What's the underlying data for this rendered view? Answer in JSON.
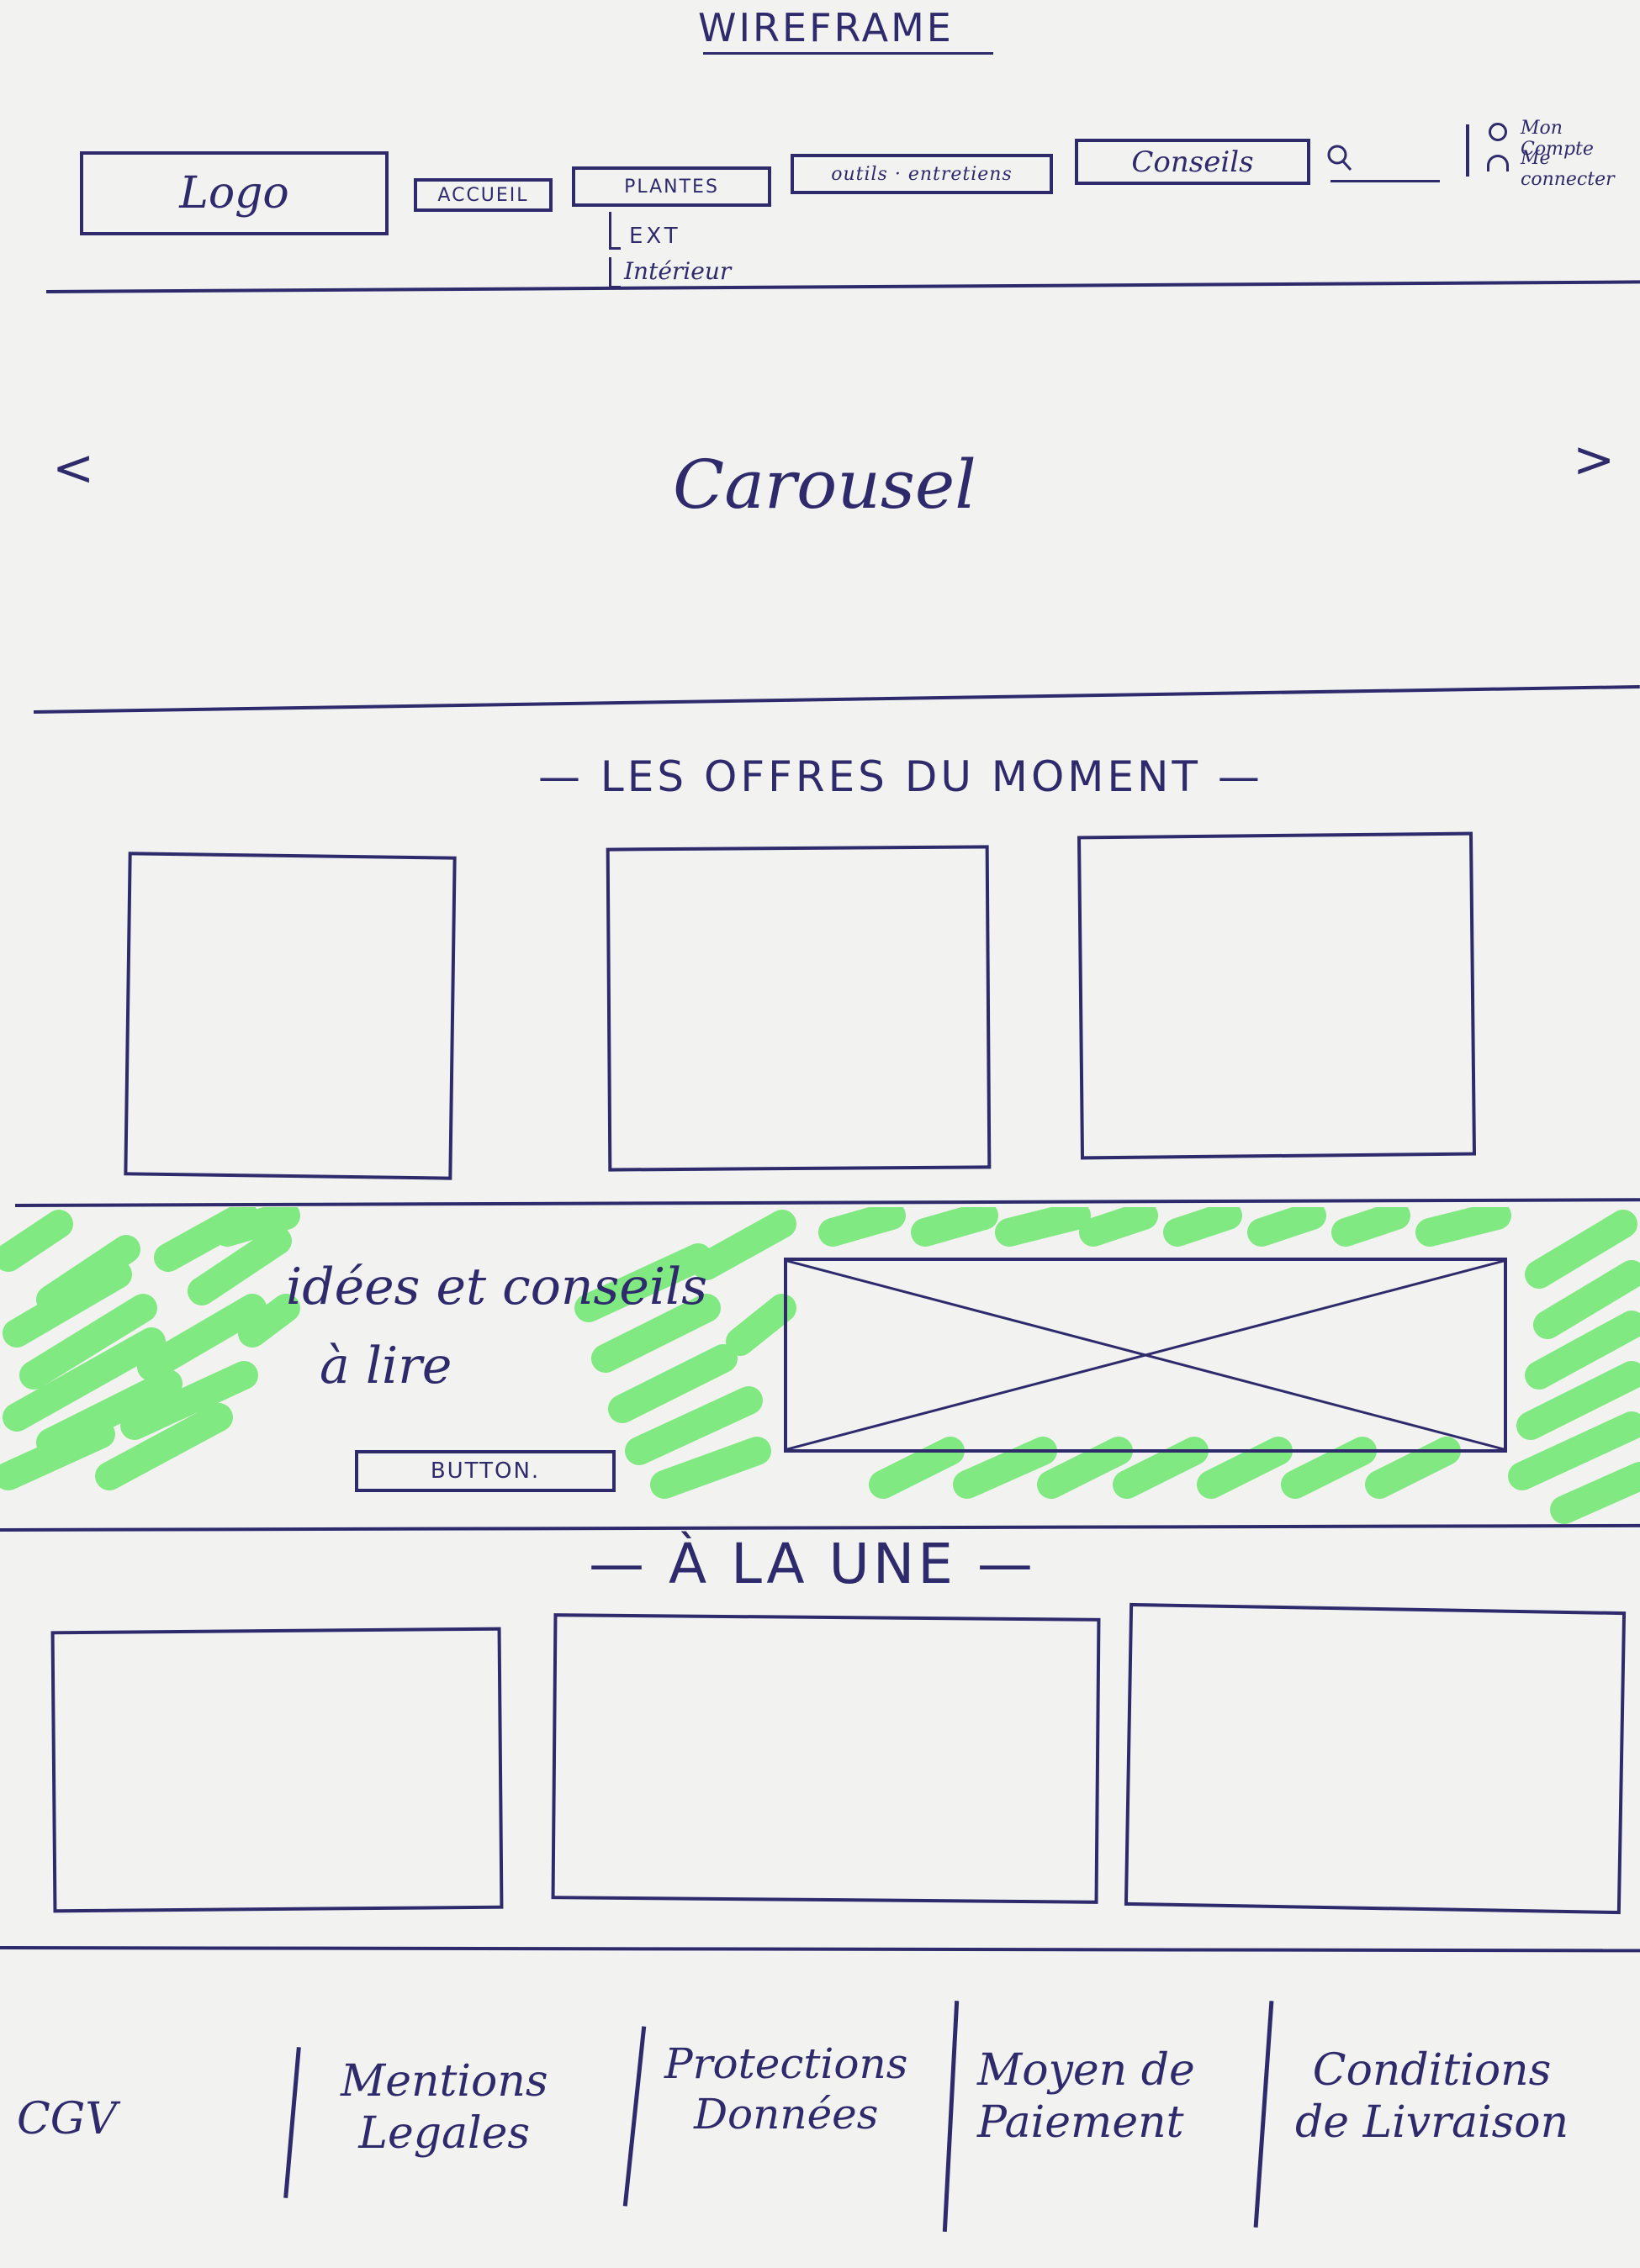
{
  "page": {
    "title": "WIREFRAME"
  },
  "header": {
    "logo_label": "Logo",
    "nav": {
      "accueil": "ACCUEIL",
      "plantes": "PLANTES",
      "plantes_submenu": [
        "EXT",
        "Intérieur"
      ],
      "outils": "outils · entretiens",
      "conseils": "Conseils"
    },
    "search_icon": "search-icon",
    "account": {
      "icon": "user-icon",
      "lines": [
        "Mon Compte",
        "Me connecter"
      ]
    }
  },
  "carousel": {
    "label": "Carousel",
    "prev": "<",
    "next": ">"
  },
  "offres": {
    "title": "— LES OFFRES DU MOMENT —",
    "card_count": 3
  },
  "idees": {
    "line1": "idées et conseils",
    "line2": "à lire",
    "button_label": "BUTTON.",
    "highlight_color": "#6ee86e"
  },
  "une": {
    "title": "— À LA UNE —",
    "card_count": 3
  },
  "footer": {
    "links": [
      {
        "line1": "CGV",
        "line2": ""
      },
      {
        "line1": "Mentions",
        "line2": "Legales"
      },
      {
        "line1": "Protections",
        "line2": "Données"
      },
      {
        "line1": "Moyen de",
        "line2": "Paiement"
      },
      {
        "line1": "Conditions",
        "line2": "de Livraison"
      }
    ]
  },
  "colors": {
    "ink": "#2e2a6b",
    "paper": "#f2f2f0",
    "highlighter": "#6ee86e"
  }
}
